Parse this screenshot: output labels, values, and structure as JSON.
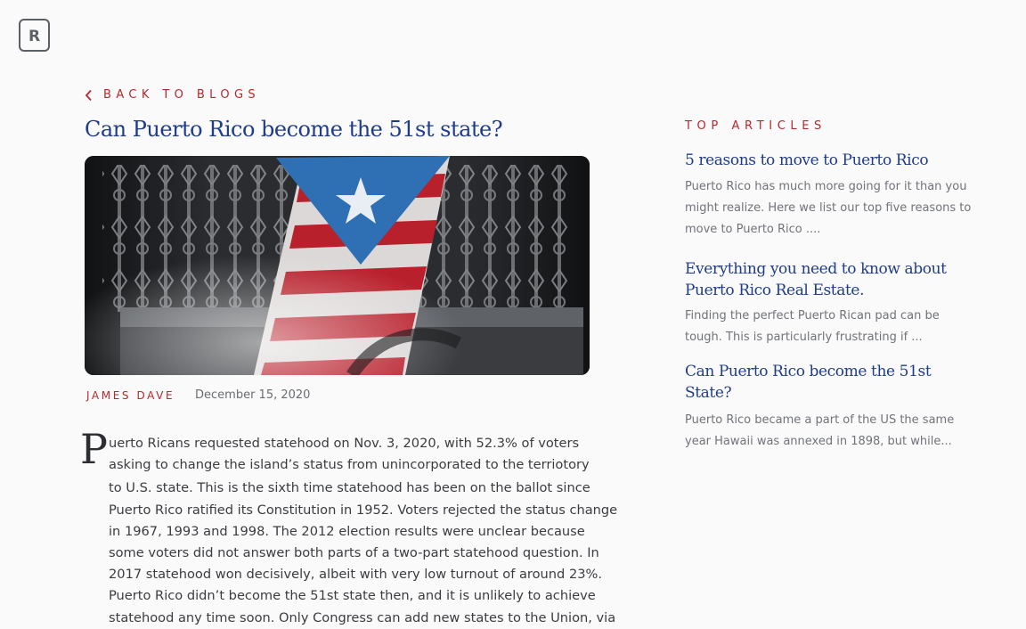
{
  "logo": {
    "letter": "R"
  },
  "back": {
    "label": "BACK TO BLOGS"
  },
  "post": {
    "title": "Can Puerto Rico become the 51st state?",
    "author": "JAMES DAVE",
    "date": "December 15, 2020",
    "dropcap": "P",
    "body_lines": [
      "uerto Ricans requested statehood on Nov. 3, 2020, with 52.3% of voters",
      "asking to change the island’s status from unincorporated to the terriotory",
      "to U.S. state. This is the sixth time statehood has been on the ballot since",
      "Puerto Rico ratified its Constitution in 1952. Voters rejected the status change",
      "in 1967, 1993 and 1998. The 2012 election results were unclear because",
      "some voters did not answer both parts of a two-part statehood question. In",
      "2017 statehood won decisively, albeit with very low turnout of around 23%.",
      "Puerto Rico didn’t become the 51st state then, and it is unlikely to achieve",
      "statehood any time soon. Only Congress can add new states to the Union, via"
    ]
  },
  "sidebar": {
    "heading": "TOP ARTICLES",
    "articles": [
      {
        "title_lines": [
          "5 reasons to move to Puerto Rico"
        ],
        "excerpt_lines": [
          "Puerto Rico has much more going for it than you",
          "might realize. Here we list our top five reasons to",
          "move to Puerto Rico ...."
        ]
      },
      {
        "title_lines": [
          "Everything you need to know about",
          "Puerto Rico Real Estate."
        ],
        "excerpt_lines": [
          "Finding the perfect Puerto Rican pad can be",
          "tough. This is particularly frustrating if ..."
        ]
      },
      {
        "title_lines": [
          "Can  Puerto Rico become the 51st",
          "State?"
        ],
        "excerpt_lines": [
          "Puerto Rico became a part of the US the same",
          "year Hawaii was annexed in 1898, but while..."
        ]
      }
    ]
  },
  "colors": {
    "accent_red": "#b7282e",
    "link_blue": "#1f3c8a",
    "background": "#fafafa"
  },
  "icons": {
    "back": "chevron-left-icon"
  }
}
